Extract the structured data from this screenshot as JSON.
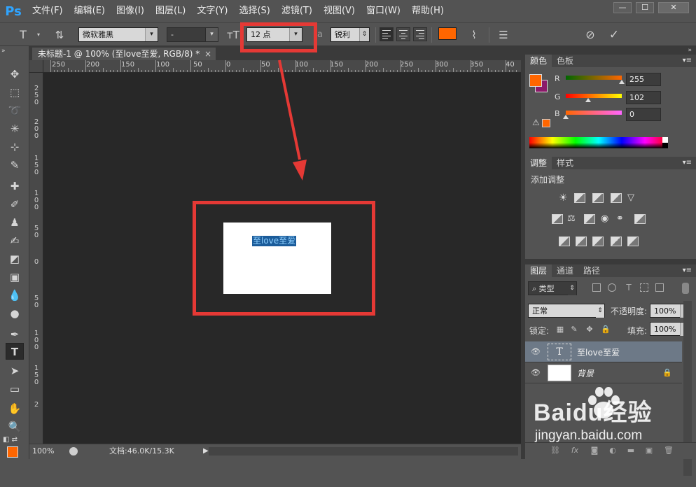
{
  "app": {
    "logo": "Ps",
    "menu": [
      "文件(F)",
      "编辑(E)",
      "图像(I)",
      "图层(L)",
      "文字(Y)",
      "选择(S)",
      "滤镜(T)",
      "视图(V)",
      "窗口(W)",
      "帮助(H)"
    ],
    "window_controls": [
      "—",
      "☐",
      "✕"
    ]
  },
  "options_bar": {
    "tool_glyph": "T",
    "font_family": "微软雅黑",
    "font_style": "-",
    "font_size": "12 点",
    "aa_label": "a",
    "antialias": "锐利",
    "text_color": "#ff6600",
    "cancel_icon": "⊘",
    "commit_icon": "✓"
  },
  "document": {
    "tab_title": "未标题-1 @ 100% (至love至爱, RGB/8) *",
    "tab_close": "×",
    "text_content": "至love至爱",
    "zoom": "100%",
    "doc_size": "文档:46.0K/15.3K",
    "ruler_h": [
      "250",
      "200",
      "150",
      "100",
      "50",
      "0",
      "50",
      "100",
      "150",
      "200",
      "250",
      "300",
      "350",
      "40"
    ],
    "ruler_v": [
      [
        "2",
        "5",
        "0"
      ],
      [
        "2",
        "0",
        "0"
      ],
      [
        "1",
        "5",
        "0"
      ],
      [
        "1",
        "0",
        "0"
      ],
      [
        "5",
        "0"
      ],
      [
        "0"
      ],
      [
        "5",
        "0"
      ],
      [
        "1",
        "0",
        "0"
      ],
      [
        "1",
        "5",
        "0"
      ],
      [
        "2"
      ]
    ]
  },
  "color_panel": {
    "tabs": [
      "颜色",
      "色板"
    ],
    "fg_color": "#ff6600",
    "bg_color": "#8c1a6a",
    "channels": [
      {
        "name": "R",
        "value": "255",
        "fraction": 1.0
      },
      {
        "name": "G",
        "value": "102",
        "fraction": 0.4
      },
      {
        "name": "B",
        "value": "0",
        "fraction": 0.0
      }
    ]
  },
  "adjustments_panel": {
    "tabs": [
      "调整",
      "样式"
    ],
    "label": "添加调整"
  },
  "layers_panel": {
    "tabs": [
      "图层",
      "通道",
      "路径"
    ],
    "filter_label": "类型",
    "blend_mode": "正常",
    "opacity_label": "不透明度:",
    "opacity_value": "100%",
    "lock_label": "锁定:",
    "fill_label": "填充:",
    "fill_value": "100%",
    "layers": [
      {
        "name": "至love至爱",
        "type": "text",
        "selected": true
      },
      {
        "name": "背景",
        "type": "background",
        "selected": false
      }
    ]
  },
  "watermark": {
    "logo": "Baidu经验",
    "url": "jingyan.baidu.com"
  },
  "annotation_color": "#e53935"
}
